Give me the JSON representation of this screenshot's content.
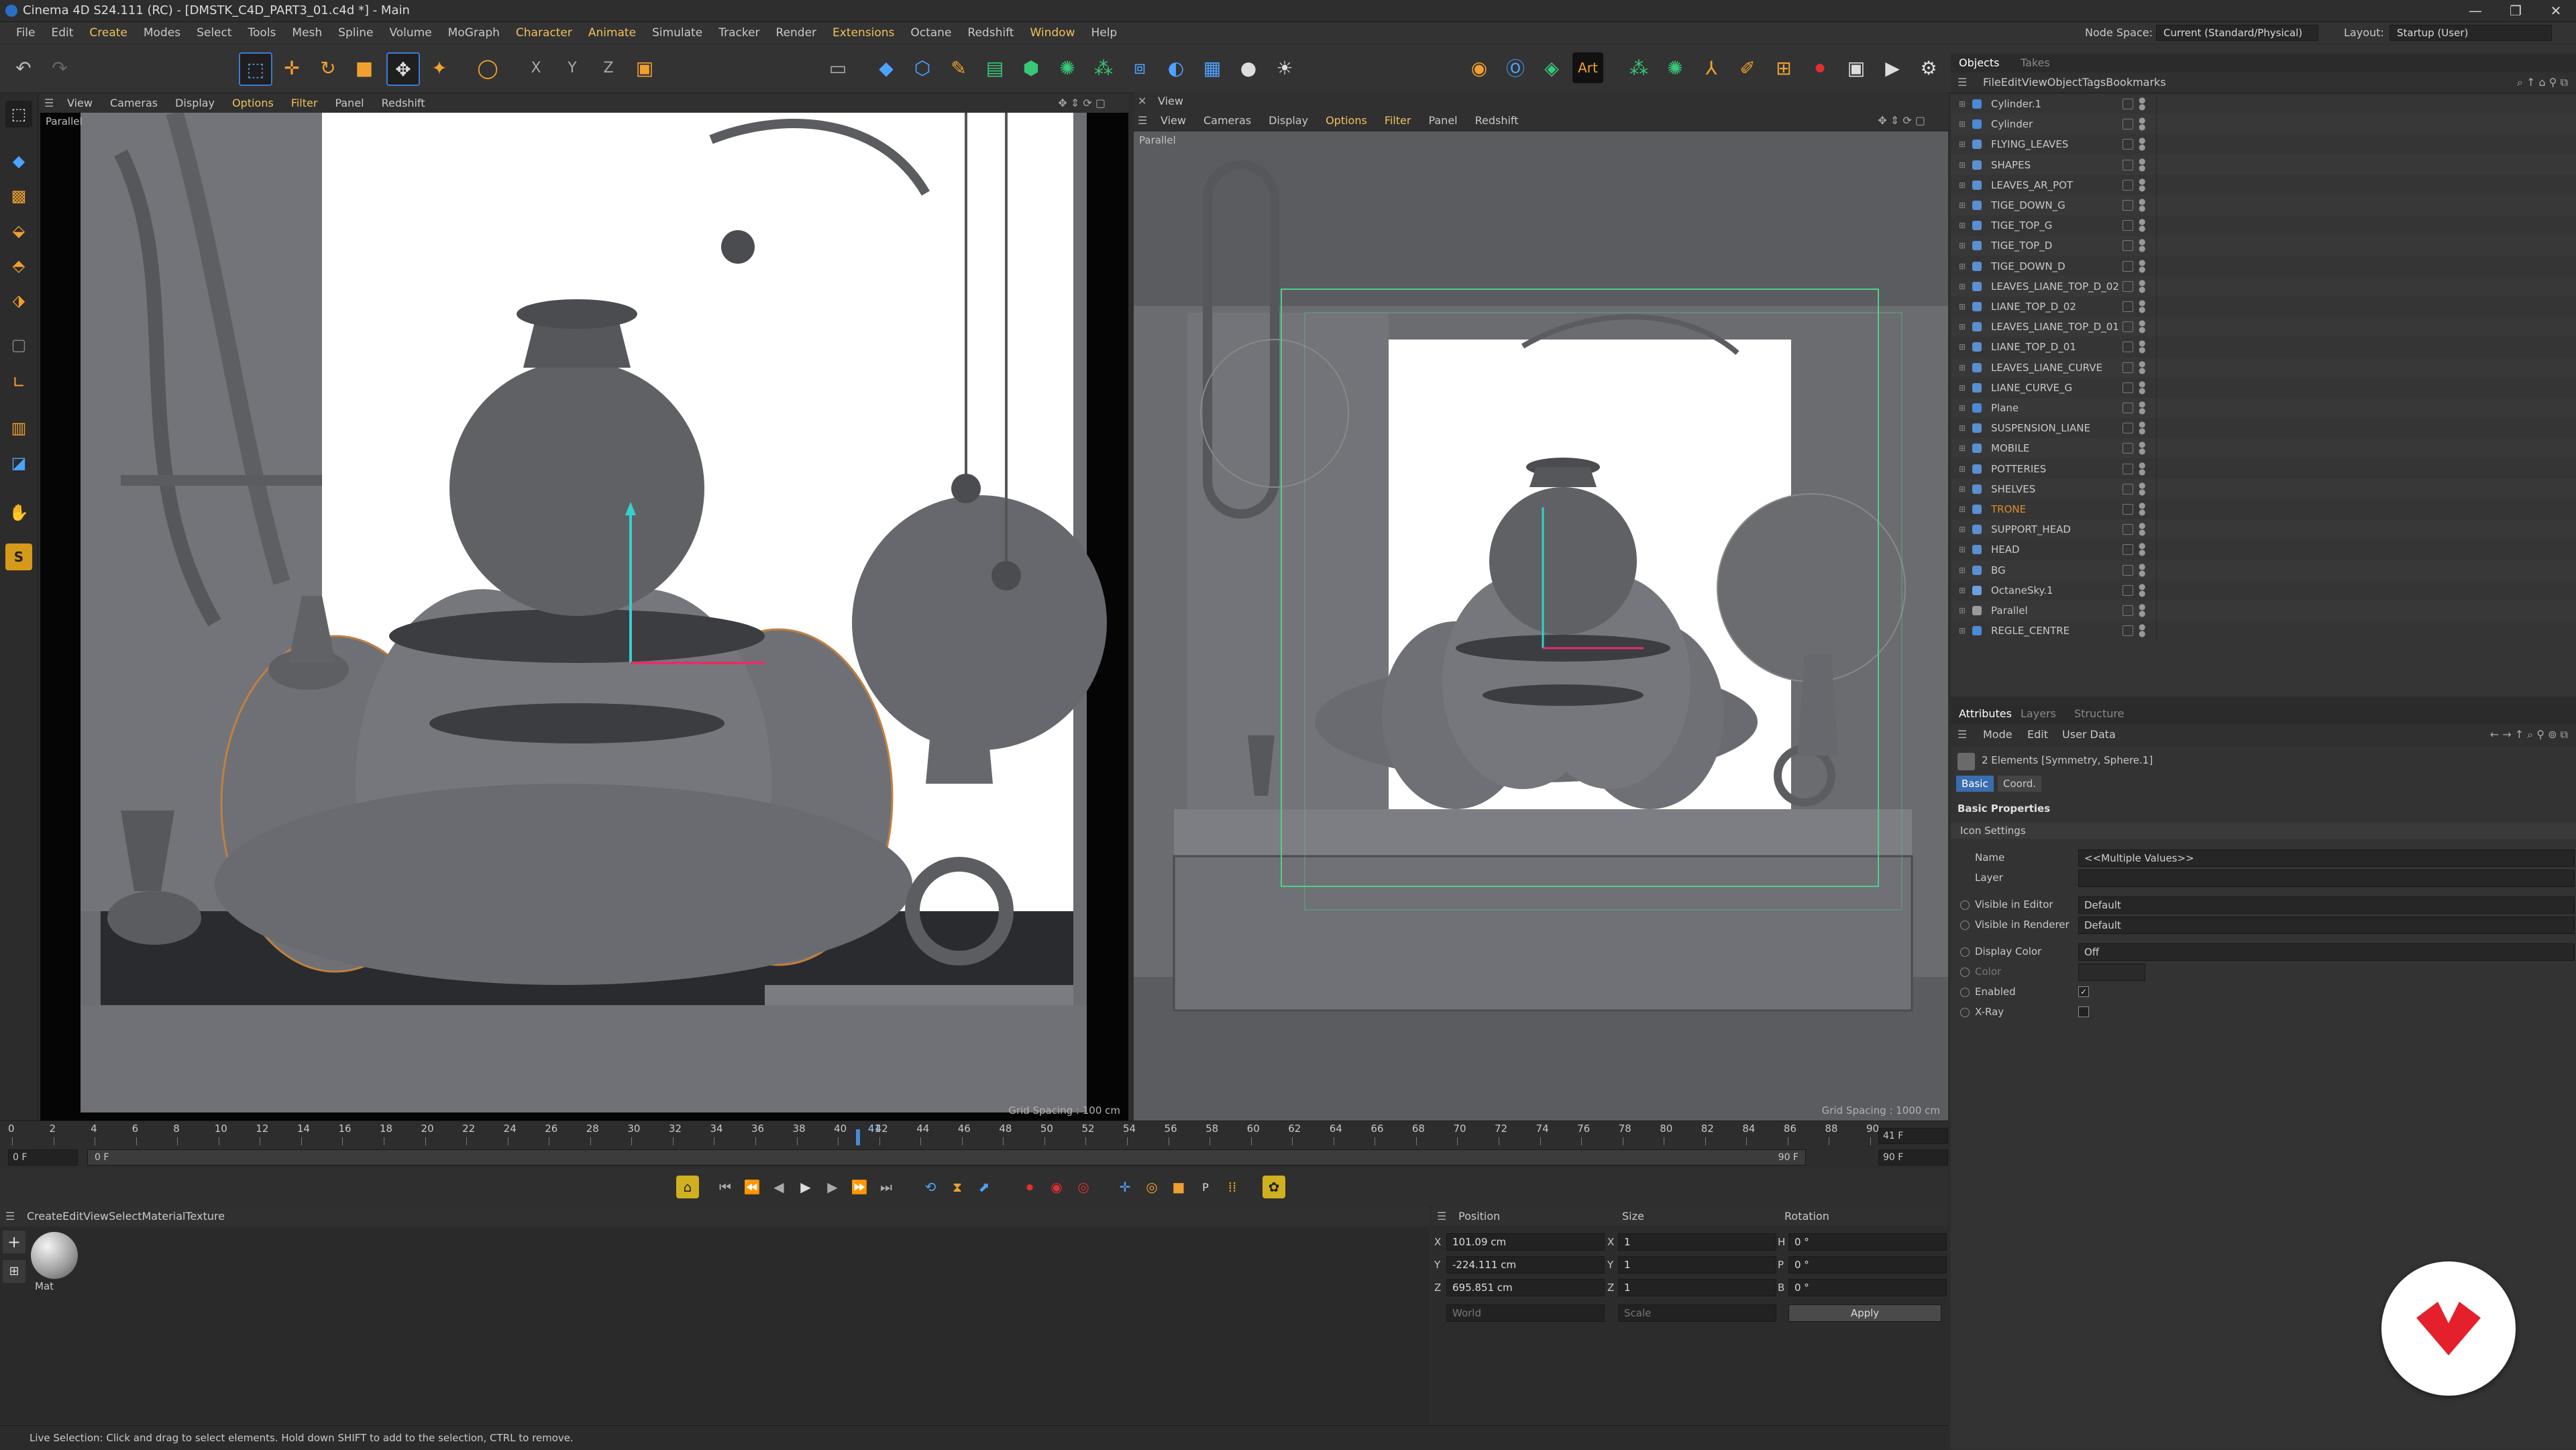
{
  "window": {
    "title": "Cinema 4D S24.111 (RC) - [DMSTK_C4D_PART3_01.c4d *] - Main",
    "controls": [
      "—",
      "❐",
      "✕"
    ]
  },
  "menubar": {
    "items": [
      "File",
      "Edit",
      "Create",
      "Modes",
      "Select",
      "Tools",
      "Mesh",
      "Spline",
      "Volume",
      "MoGraph",
      "Character",
      "Animate",
      "Simulate",
      "Tracker",
      "Render",
      "Extensions",
      "Octane",
      "Redshift",
      "Window",
      "Help"
    ],
    "node_space_label": "Node Space:",
    "node_space_value": "Current (Standard/Physical)",
    "layout_label": "Layout:",
    "layout_value": "Startup (User)"
  },
  "viewport_left": {
    "menu": [
      "View",
      "Cameras",
      "Display",
      "Options",
      "Filter",
      "Panel",
      "Redshift"
    ],
    "label": "Parallel",
    "grid_spacing": "Grid Spacing : 100 cm"
  },
  "viewport_right": {
    "header": "View",
    "menu": [
      "View",
      "Cameras",
      "Display",
      "Options",
      "Filter",
      "Panel",
      "Redshift"
    ],
    "label": "Parallel",
    "grid_spacing": "Grid Spacing : 1000 cm"
  },
  "timeline": {
    "ticks": [
      "0",
      "2",
      "4",
      "6",
      "8",
      "10",
      "12",
      "14",
      "16",
      "18",
      "20",
      "22",
      "24",
      "26",
      "28",
      "30",
      "32",
      "34",
      "36",
      "38",
      "40",
      "42",
      "44",
      "46",
      "48",
      "50",
      "52",
      "54",
      "56",
      "58",
      "60",
      "62",
      "64",
      "66",
      "68",
      "70",
      "72",
      "74",
      "76",
      "78",
      "80",
      "82",
      "84",
      "86",
      "88",
      "90"
    ],
    "current_frame": "41",
    "current_frame_field": "41 F",
    "start_field": "0 F",
    "start_field2": "0 F",
    "end_field": "90 F",
    "end_field2": "90 F"
  },
  "material_panel": {
    "menu": [
      "Create",
      "Edit",
      "View",
      "Select",
      "Material",
      "Texture"
    ],
    "materials": [
      {
        "name": "Mat"
      }
    ]
  },
  "coordinates": {
    "headers": [
      "Position",
      "Size",
      "Rotation"
    ],
    "rows": [
      {
        "axis": "X",
        "pos": "101.09 cm",
        "size_axis": "X",
        "size": "1",
        "rot_axis": "H",
        "rot": "0 °"
      },
      {
        "axis": "Y",
        "pos": "-224.111 cm",
        "size_axis": "Y",
        "size": "1",
        "rot_axis": "P",
        "rot": "0 °"
      },
      {
        "axis": "Z",
        "pos": "695.851 cm",
        "size_axis": "Z",
        "size": "1",
        "rot_axis": "B",
        "rot": "0 °"
      }
    ],
    "space_value": "World",
    "mode_value": "Scale",
    "apply_label": "Apply"
  },
  "status": {
    "text": "Live Selection: Click and drag to select elements. Hold down SHIFT to add to the selection, CTRL to remove."
  },
  "object_manager": {
    "tabs": [
      "Objects",
      "Takes"
    ],
    "menu": [
      "File",
      "Edit",
      "View",
      "Object",
      "Tags",
      "Bookmarks"
    ],
    "objects": [
      {
        "name": "Cylinder.1",
        "color": "#4a8ad6",
        "highlight": false
      },
      {
        "name": "Cylinder",
        "color": "#4a8ad6",
        "highlight": false
      },
      {
        "name": "FLYING_LEAVES",
        "color": "#5a8fd0",
        "highlight": false
      },
      {
        "name": "SHAPES",
        "color": "#5a8fd0",
        "highlight": false
      },
      {
        "name": "LEAVES_AR_POT",
        "color": "#5a8fd0",
        "highlight": false
      },
      {
        "name": "TIGE_DOWN_G",
        "color": "#5a8fd0",
        "highlight": false
      },
      {
        "name": "TIGE_TOP_G",
        "color": "#5a8fd0",
        "highlight": false
      },
      {
        "name": "TIGE_TOP_D",
        "color": "#5a8fd0",
        "highlight": false
      },
      {
        "name": "TIGE_DOWN_D",
        "color": "#5a8fd0",
        "highlight": false
      },
      {
        "name": "LEAVES_LIANE_TOP_D_02",
        "color": "#5a8fd0",
        "highlight": false
      },
      {
        "name": "LIANE_TOP_D_02",
        "color": "#5a8fd0",
        "highlight": false
      },
      {
        "name": "LEAVES_LIANE_TOP_D_01",
        "color": "#5a8fd0",
        "highlight": false
      },
      {
        "name": "LIANE_TOP_D_01",
        "color": "#5a8fd0",
        "highlight": false
      },
      {
        "name": "LEAVES_LIANE_CURVE",
        "color": "#5a8fd0",
        "highlight": false
      },
      {
        "name": "LIANE_CURVE_G",
        "color": "#5a8fd0",
        "highlight": false
      },
      {
        "name": "Plane",
        "color": "#4a8ad6",
        "highlight": false
      },
      {
        "name": "SUSPENSION_LIANE",
        "color": "#5a8fd0",
        "highlight": false
      },
      {
        "name": "MOBILE",
        "color": "#5a8fd0",
        "highlight": false
      },
      {
        "name": "POTTERIES",
        "color": "#5a8fd0",
        "highlight": false
      },
      {
        "name": "SHELVES",
        "color": "#5a8fd0",
        "highlight": false
      },
      {
        "name": "TRONE",
        "color": "#5a8fd0",
        "highlight": true
      },
      {
        "name": "SUPPORT_HEAD",
        "color": "#5a8fd0",
        "highlight": false
      },
      {
        "name": "HEAD",
        "color": "#5a8fd0",
        "highlight": false
      },
      {
        "name": "BG",
        "color": "#5a8fd0",
        "highlight": false
      },
      {
        "name": "OctaneSky.1",
        "color": "#6aa0e0",
        "highlight": false
      },
      {
        "name": "Parallel",
        "color": "#9a9a9a",
        "highlight": false
      },
      {
        "name": "REGLE_CENTRE",
        "color": "#4a8ad6",
        "highlight": false
      }
    ]
  },
  "attributes": {
    "tabs": [
      "Attributes",
      "Layers",
      "Structure"
    ],
    "menu": [
      "Mode",
      "Edit",
      "User Data"
    ],
    "selection": "2 Elements [Symmetry, Sphere.1]",
    "subtabs": [
      "Basic",
      "Coord."
    ],
    "section": "Basic Properties",
    "icon_settings": "Icon Settings",
    "fields": [
      {
        "label": "Name",
        "value": "<<Multiple Values>>"
      },
      {
        "label": "Layer",
        "value": ""
      },
      {
        "label": "Visible in Editor",
        "value": "Default"
      },
      {
        "label": "Visible in Renderer",
        "value": "Default"
      },
      {
        "label": "Display Color",
        "value": "Off"
      },
      {
        "label": "Color",
        "value": ""
      },
      {
        "label": "Enabled",
        "value": "checked"
      },
      {
        "label": "X-Ray",
        "value": "unchecked"
      }
    ]
  }
}
